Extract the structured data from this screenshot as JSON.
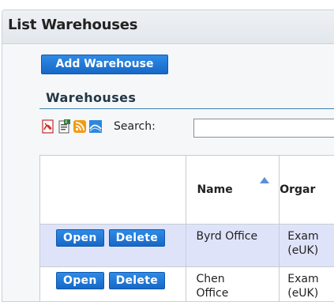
{
  "panel": {
    "title": "List Warehouses"
  },
  "actions": {
    "add_label": "Add Warehouse"
  },
  "section": {
    "heading": "Warehouses"
  },
  "toolbar": {
    "icons": [
      "pdf-icon",
      "export-csv-icon",
      "rss-icon",
      "chart-icon"
    ],
    "search_label": "Search:",
    "search_value": ""
  },
  "table": {
    "columns": [
      "",
      "Name",
      "Orgar"
    ],
    "sort_column": "Name",
    "sort_direction": "ascending",
    "rows": [
      {
        "open_label": "Open",
        "delete_label": "Delete",
        "name_line1": "Byrd Office",
        "name_line2": "",
        "org_line1": "Exam",
        "org_line2": "(eUK)"
      },
      {
        "open_label": "Open",
        "delete_label": "Delete",
        "name_line1": "Chen",
        "name_line2": "Office",
        "org_line1": "Exam",
        "org_line2": "(eUK)"
      }
    ]
  },
  "colors": {
    "button_blue": "#1f78d6",
    "selected_row": "#dfe3fa",
    "rule": "#3d7fae"
  }
}
